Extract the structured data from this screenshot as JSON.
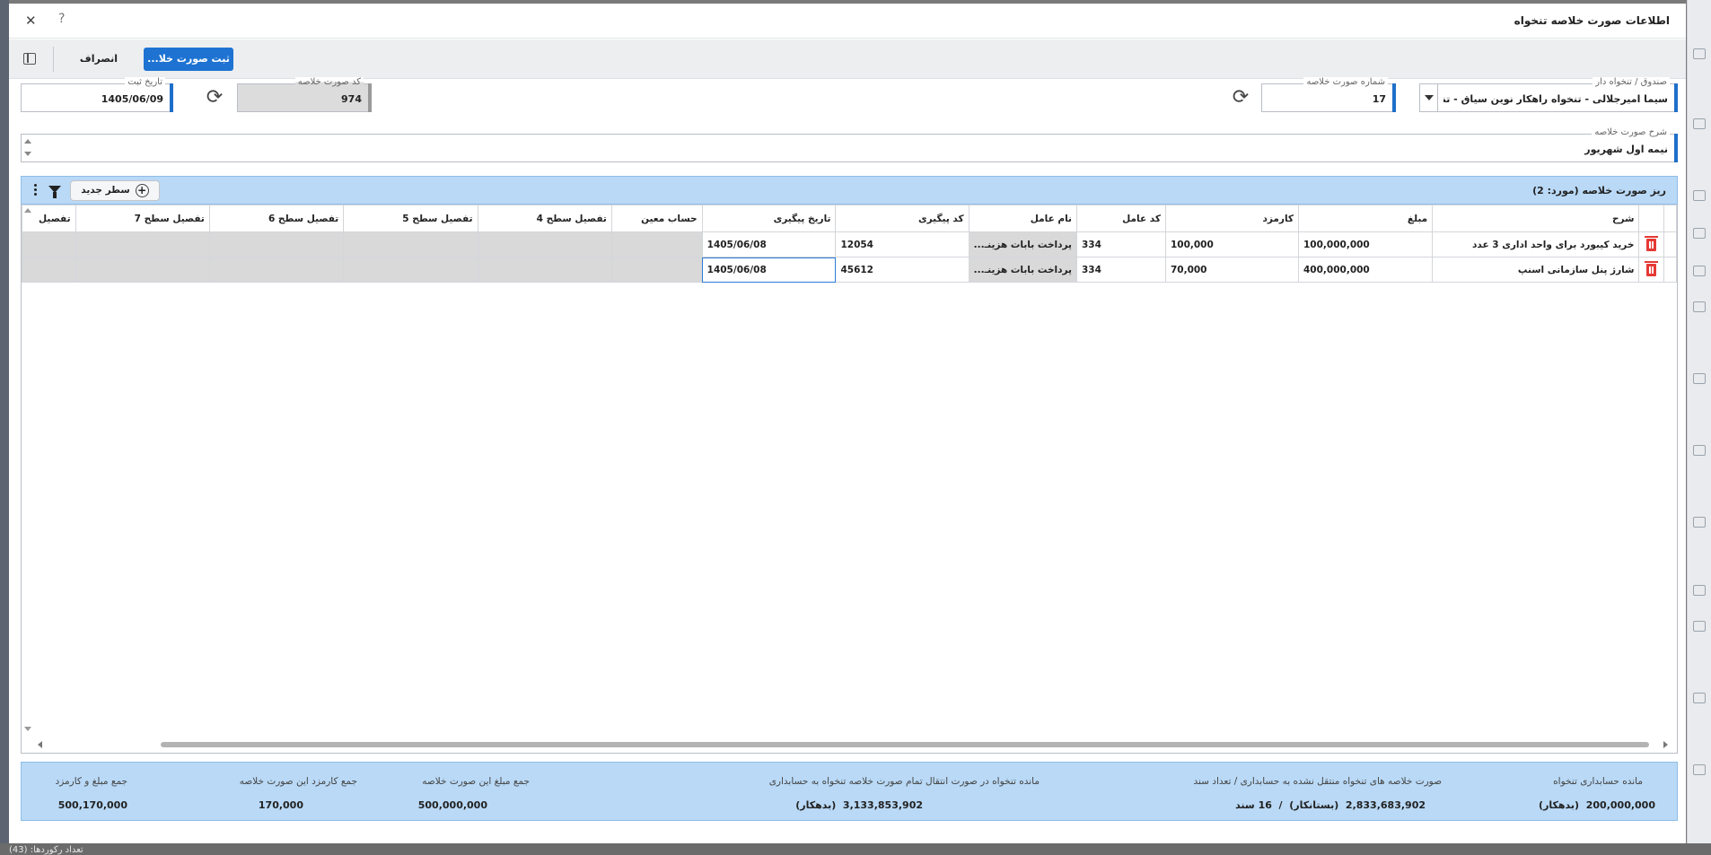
{
  "window": {
    "title": "اطلاعات صورت خلاصه تنخواه",
    "help": "?",
    "close": "✕"
  },
  "toolbar": {
    "save_label": "ثبت صورت خلا...",
    "cancel_label": "انصراف"
  },
  "form": {
    "fund": {
      "label": "صندوق / تنخواه دار",
      "value": "سیما امیرجلالی - تنخواه راهکار نوین سیاق - تنخواه..."
    },
    "summary_number": {
      "label": "شماره صورت خلاصه",
      "value": "17"
    },
    "summary_code": {
      "label": "کد صورت خلاصه",
      "value": "974"
    },
    "register_date": {
      "label": "تاریخ ثبت",
      "value": "1405/06/09"
    },
    "description": {
      "label": "شرح صورت خلاصه",
      "value": "نیمه اول شهریور"
    }
  },
  "grid": {
    "title": "ریز صورت خلاصه (مورد: 2)",
    "new_row_label": "سطر جدید",
    "columns": [
      "",
      "",
      "شرح",
      "مبلغ",
      "کارمزد",
      "کد عامل",
      "نام عامل",
      "کد پیگیری",
      "تاریخ پیگیری",
      "حساب معین",
      "تفصیل سطح 4",
      "تفصیل سطح 5",
      "تفصیل سطح 6",
      "تفصیل سطح 7",
      "تفصیل"
    ],
    "rows": [
      {
        "desc": "خرید کیبورد برای واحد اداری 3 عدد",
        "amount": "100,000,000",
        "fee": "100,000",
        "agent_code": "334",
        "agent_name": "پرداخت بابات هزینـ...",
        "track_code": "12054",
        "track_date": "1405/06/08"
      },
      {
        "desc": "شارژ پنل سازمانی اسنپ",
        "amount": "400,000,000",
        "fee": "70,000",
        "agent_code": "334",
        "agent_name": "پرداخت بابات هزینـ...",
        "track_code": "45612",
        "track_date": "1405/06/08"
      }
    ]
  },
  "summary": {
    "balance": {
      "label": "مانده حسابداری تنخواه",
      "value": "200,000,000",
      "suffix": "(بدهکار)"
    },
    "untransferred": {
      "label": "صورت خلاصه های تنخواه منتقل نشده به حسابداری / تعداد سند",
      "value": "2,833,683,902",
      "suffix": "(بستانکار)",
      "sep": "/",
      "count": "16 سند"
    },
    "remaining_after": {
      "label": "مانده تنخواه در صورت انتقال تمام صورت خلاصه تنخواه به حسابداری",
      "value": "3,133,853,902",
      "suffix": "(بدهکار)"
    },
    "sum_amount": {
      "label": "جمع مبلغ این صورت خلاصه",
      "value": "500,000,000"
    },
    "sum_fee": {
      "label": "جمع کارمزد این صورت خلاصه",
      "value": "170,000"
    },
    "sum_total": {
      "label": "جمع مبلغ و کارمزد",
      "value": "500,170,000"
    }
  },
  "background": {
    "status_text": "تعداد رکوردها: (43)"
  }
}
